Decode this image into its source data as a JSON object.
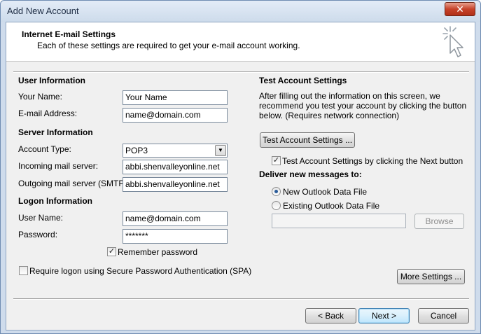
{
  "window": {
    "title": "Add New Account",
    "close_symbol": "✕"
  },
  "header": {
    "title": "Internet E-mail Settings",
    "subtitle": "Each of these settings are required to get your e-mail account working.",
    "icon": "sparkle-cursor-icon"
  },
  "user_info": {
    "heading": "User Information",
    "name_label": "Your Name:",
    "name_value": "Your Name",
    "email_label": "E-mail Address:",
    "email_value": "name@domain.com"
  },
  "server_info": {
    "heading": "Server Information",
    "account_type_label": "Account Type:",
    "account_type_value": "POP3",
    "incoming_label": "Incoming mail server:",
    "incoming_value": "abbi.shenvalleyonline.net",
    "outgoing_label": "Outgoing mail server (SMTP):",
    "outgoing_value": "abbi.shenvalleyonline.net"
  },
  "logon_info": {
    "heading": "Logon Information",
    "username_label": "User Name:",
    "username_value": "name@domain.com",
    "password_label": "Password:",
    "password_value": "*******",
    "remember_label": "Remember password",
    "remember_checked": true,
    "spa_label": "Require logon using Secure Password Authentication (SPA)",
    "spa_checked": false
  },
  "test_settings": {
    "heading": "Test Account Settings",
    "description": [
      "After filling out the information on this screen, we",
      "recommend you test your account by clicking the button",
      "below. (Requires network connection)"
    ],
    "test_button": "Test Account Settings ...",
    "test_next_label": "Test Account Settings by clicking the Next button",
    "test_next_checked": true
  },
  "deliver": {
    "heading": "Deliver new messages to:",
    "new_file_label": "New Outlook Data File",
    "existing_file_label": "Existing Outlook Data File",
    "selected": "new",
    "browse_button": "Browse"
  },
  "more_settings_button": "More Settings ...",
  "footer": {
    "back_button": "< Back",
    "next_button": "Next >",
    "cancel_button": "Cancel"
  },
  "colors": {
    "title_bar": "#cddbeb",
    "close_button": "#c7432a",
    "default_button_border": "#3c7fb1"
  }
}
